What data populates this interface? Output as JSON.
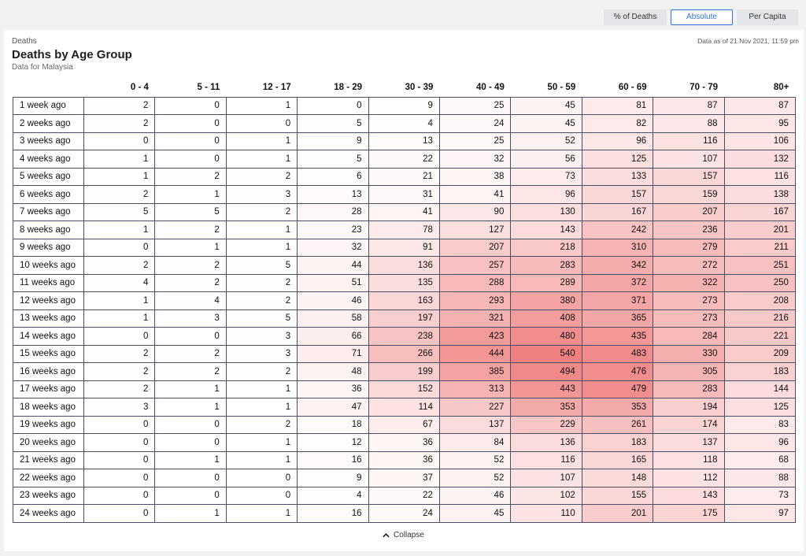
{
  "toggles": {
    "percent_label": "% of Deaths",
    "absolute_label": "Absolute",
    "per_capita_label": "Per Capita"
  },
  "card": {
    "overline": "Deaths",
    "title": "Deaths by Age Group",
    "subtitle": "Data for Malaysia",
    "as_of": "Data as of 21 Nov 2021, 11:59 pm"
  },
  "collapse_label": "Collapse",
  "colors": {
    "accent": "#2f6fd6",
    "heat_max": "#f07f7f",
    "heat_min": "#ffffff"
  },
  "icons": {
    "collapse": "chevron-up-icon"
  },
  "chart_data": {
    "type": "heatmap",
    "x": [
      "0 - 4",
      "5 - 11",
      "12 - 17",
      "18 - 29",
      "30 - 39",
      "40 - 49",
      "50 - 59",
      "60 - 69",
      "70 - 79",
      "80+"
    ],
    "y": [
      "1 week ago",
      "2 weeks ago",
      "3 weeks ago",
      "4 weeks ago",
      "5 weeks ago",
      "6 weeks ago",
      "7 weeks ago",
      "8 weeks ago",
      "9 weeks ago",
      "10 weeks ago",
      "11 weeks ago",
      "12 weeks ago",
      "13 weeks ago",
      "14 weeks ago",
      "15 weeks ago",
      "16 weeks ago",
      "17 weeks ago",
      "18 weeks ago",
      "19 weeks ago",
      "20 weeks ago",
      "21 weeks ago",
      "22 weeks ago",
      "23 weeks ago",
      "24 weeks ago"
    ],
    "values": [
      [
        2,
        0,
        1,
        0,
        9,
        25,
        45,
        81,
        87,
        87
      ],
      [
        2,
        0,
        0,
        5,
        4,
        24,
        45,
        82,
        88,
        95
      ],
      [
        0,
        0,
        1,
        9,
        13,
        25,
        52,
        96,
        116,
        106
      ],
      [
        1,
        0,
        1,
        5,
        22,
        32,
        56,
        125,
        107,
        132
      ],
      [
        1,
        2,
        2,
        6,
        21,
        38,
        73,
        133,
        157,
        116
      ],
      [
        2,
        1,
        3,
        13,
        31,
        41,
        96,
        157,
        159,
        138
      ],
      [
        5,
        5,
        2,
        28,
        41,
        90,
        130,
        167,
        207,
        167
      ],
      [
        1,
        2,
        1,
        23,
        78,
        127,
        143,
        242,
        236,
        201
      ],
      [
        0,
        1,
        1,
        32,
        91,
        207,
        218,
        310,
        279,
        211
      ],
      [
        2,
        2,
        5,
        44,
        136,
        257,
        283,
        342,
        272,
        251
      ],
      [
        4,
        2,
        2,
        51,
        135,
        288,
        289,
        372,
        322,
        250
      ],
      [
        1,
        4,
        2,
        46,
        163,
        293,
        380,
        371,
        273,
        208
      ],
      [
        1,
        3,
        5,
        58,
        197,
        321,
        408,
        365,
        273,
        216
      ],
      [
        0,
        0,
        3,
        66,
        238,
        423,
        480,
        435,
        284,
        221
      ],
      [
        2,
        2,
        3,
        71,
        266,
        444,
        540,
        483,
        330,
        209
      ],
      [
        2,
        2,
        2,
        48,
        199,
        385,
        494,
        476,
        305,
        183
      ],
      [
        2,
        1,
        1,
        36,
        152,
        313,
        443,
        479,
        283,
        144
      ],
      [
        3,
        1,
        1,
        47,
        114,
        227,
        353,
        353,
        194,
        125
      ],
      [
        0,
        0,
        2,
        18,
        67,
        137,
        229,
        261,
        174,
        83
      ],
      [
        0,
        0,
        1,
        12,
        36,
        84,
        136,
        183,
        137,
        96
      ],
      [
        0,
        1,
        1,
        16,
        36,
        52,
        116,
        165,
        118,
        68
      ],
      [
        0,
        0,
        0,
        9,
        37,
        52,
        107,
        148,
        112,
        88
      ],
      [
        0,
        0,
        0,
        4,
        22,
        46,
        102,
        155,
        143,
        73
      ],
      [
        0,
        1,
        1,
        16,
        24,
        45,
        110,
        201,
        175,
        97
      ]
    ],
    "color_scale": {
      "min_color": "#ffffff",
      "max_color": "#f07f7f"
    }
  }
}
